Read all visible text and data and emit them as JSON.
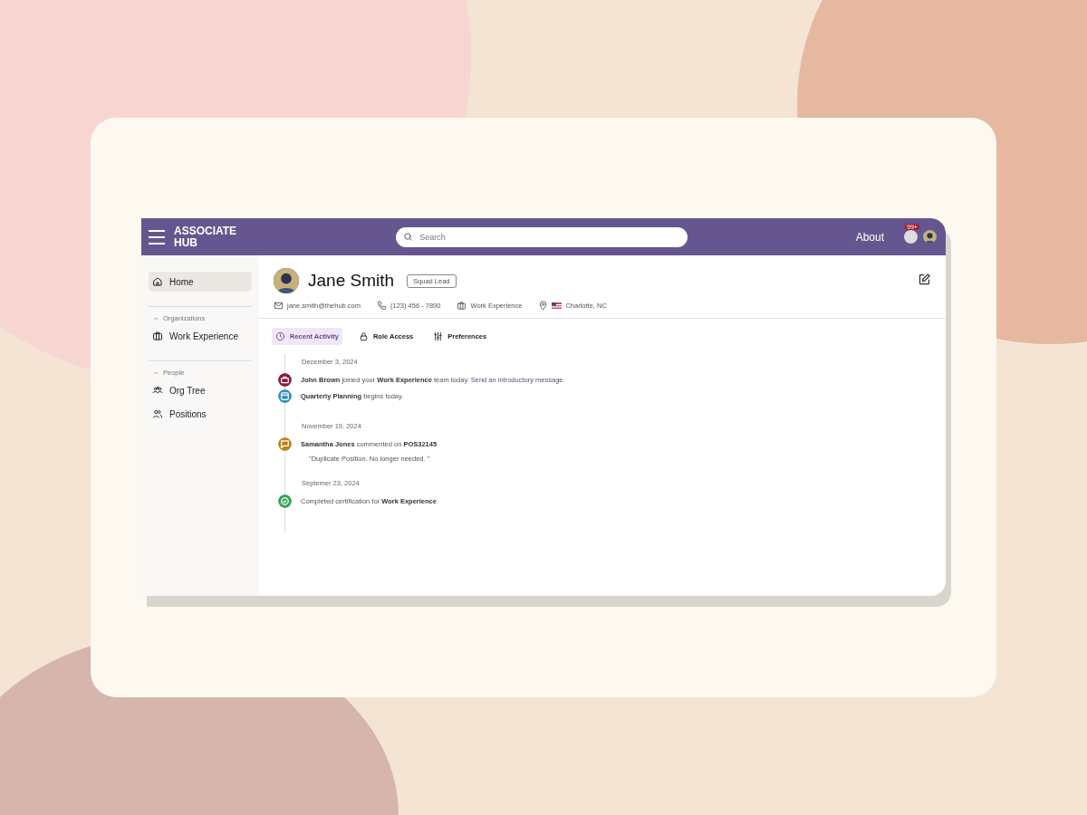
{
  "header": {
    "brand_line_1": "ASSOCIATE",
    "brand_line_2": "HUB",
    "search": {
      "placeholder": "Search"
    },
    "about": "About",
    "notification_badge": "99+"
  },
  "sidebar": {
    "items": [
      {
        "kind": "item",
        "label": "Home",
        "selected": true
      },
      {
        "kind": "section",
        "label": "Organizations",
        "expanded": true
      },
      {
        "kind": "item",
        "label": "Work Experience",
        "selected": false
      },
      {
        "kind": "section",
        "label": "People",
        "expanded": true
      },
      {
        "kind": "item",
        "label": "Org Tree",
        "selected": false
      },
      {
        "kind": "item",
        "label": "Positions",
        "selected": false
      }
    ]
  },
  "profile": {
    "name": "Jane Smith",
    "role_badge": "Squad Lead",
    "email": "jane.smith@thehub.com",
    "phone": "(123) 456 - 7890",
    "team": "Work Experience",
    "location": "Charlotte, NC"
  },
  "tabs": [
    {
      "label": "Recent Activity",
      "selected": true
    },
    {
      "label": "Role Access",
      "selected": false
    },
    {
      "label": "Preferences",
      "selected": false
    }
  ],
  "activity": [
    {
      "date": "December 3, 2024",
      "events": [
        {
          "kind": "joined",
          "color": "#8a1c3c",
          "text": "**John Brown** joined your **Work Experience** team today.",
          "link": "Send an introductory message."
        },
        {
          "kind": "calendar",
          "color": "#2f8fc4",
          "text": "**Quarterly Planning** begins today."
        }
      ]
    },
    {
      "date": "November 19, 2024",
      "events": [
        {
          "kind": "comment",
          "color": "#c0801c",
          "text": "**Samantha Jones** commented on **POS32145**",
          "detail": "\"Duplicate Position. No longer needed. \""
        }
      ]
    },
    {
      "date": "Septemer 23, 2024",
      "events": [
        {
          "kind": "check",
          "color": "#3aa05a",
          "text": "Completed certification for **Work Experience**."
        }
      ]
    }
  ]
}
